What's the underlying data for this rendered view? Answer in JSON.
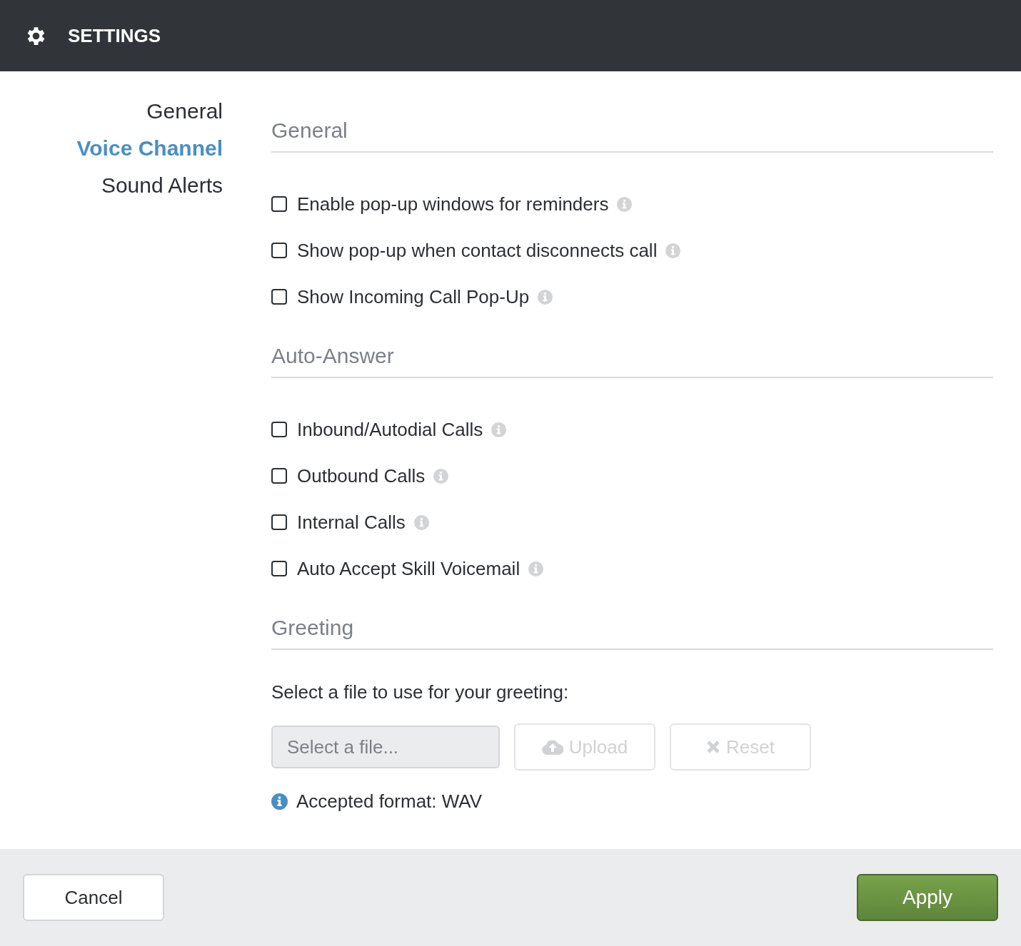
{
  "window": {
    "title": "SETTINGS"
  },
  "nav": [
    {
      "label": "General",
      "selected": false
    },
    {
      "label": "Voice Channel",
      "selected": true
    },
    {
      "label": "Sound Alerts",
      "selected": false
    }
  ],
  "sections": [
    {
      "title": "General",
      "kind": "checkboxes",
      "items": [
        {
          "label": "Enable pop-up windows for reminders",
          "checked": false
        },
        {
          "label": "Show pop-up when contact disconnects call",
          "checked": false
        },
        {
          "label": "Show Incoming Call Pop-Up",
          "checked": false
        }
      ]
    },
    {
      "title": "Auto-Answer",
      "kind": "checkboxes",
      "items": [
        {
          "label": "Inbound/Autodial Calls",
          "checked": false
        },
        {
          "label": "Outbound Calls",
          "checked": false
        },
        {
          "label": "Internal Calls",
          "checked": false
        },
        {
          "label": "Auto Accept Skill Voicemail",
          "checked": false
        }
      ]
    },
    {
      "title": "Greeting",
      "kind": "file",
      "prompt": "Select a file to use for your greeting:",
      "file_field": {
        "placeholder": "Select a file..."
      },
      "buttons": [
        {
          "label": "Upload",
          "kind": "upload",
          "disabled": true
        },
        {
          "label": "Reset",
          "kind": "reset",
          "disabled": true
        }
      ],
      "note": "Accepted format: WAV"
    }
  ],
  "footer": {
    "cancel": "Cancel",
    "apply": "Apply"
  }
}
